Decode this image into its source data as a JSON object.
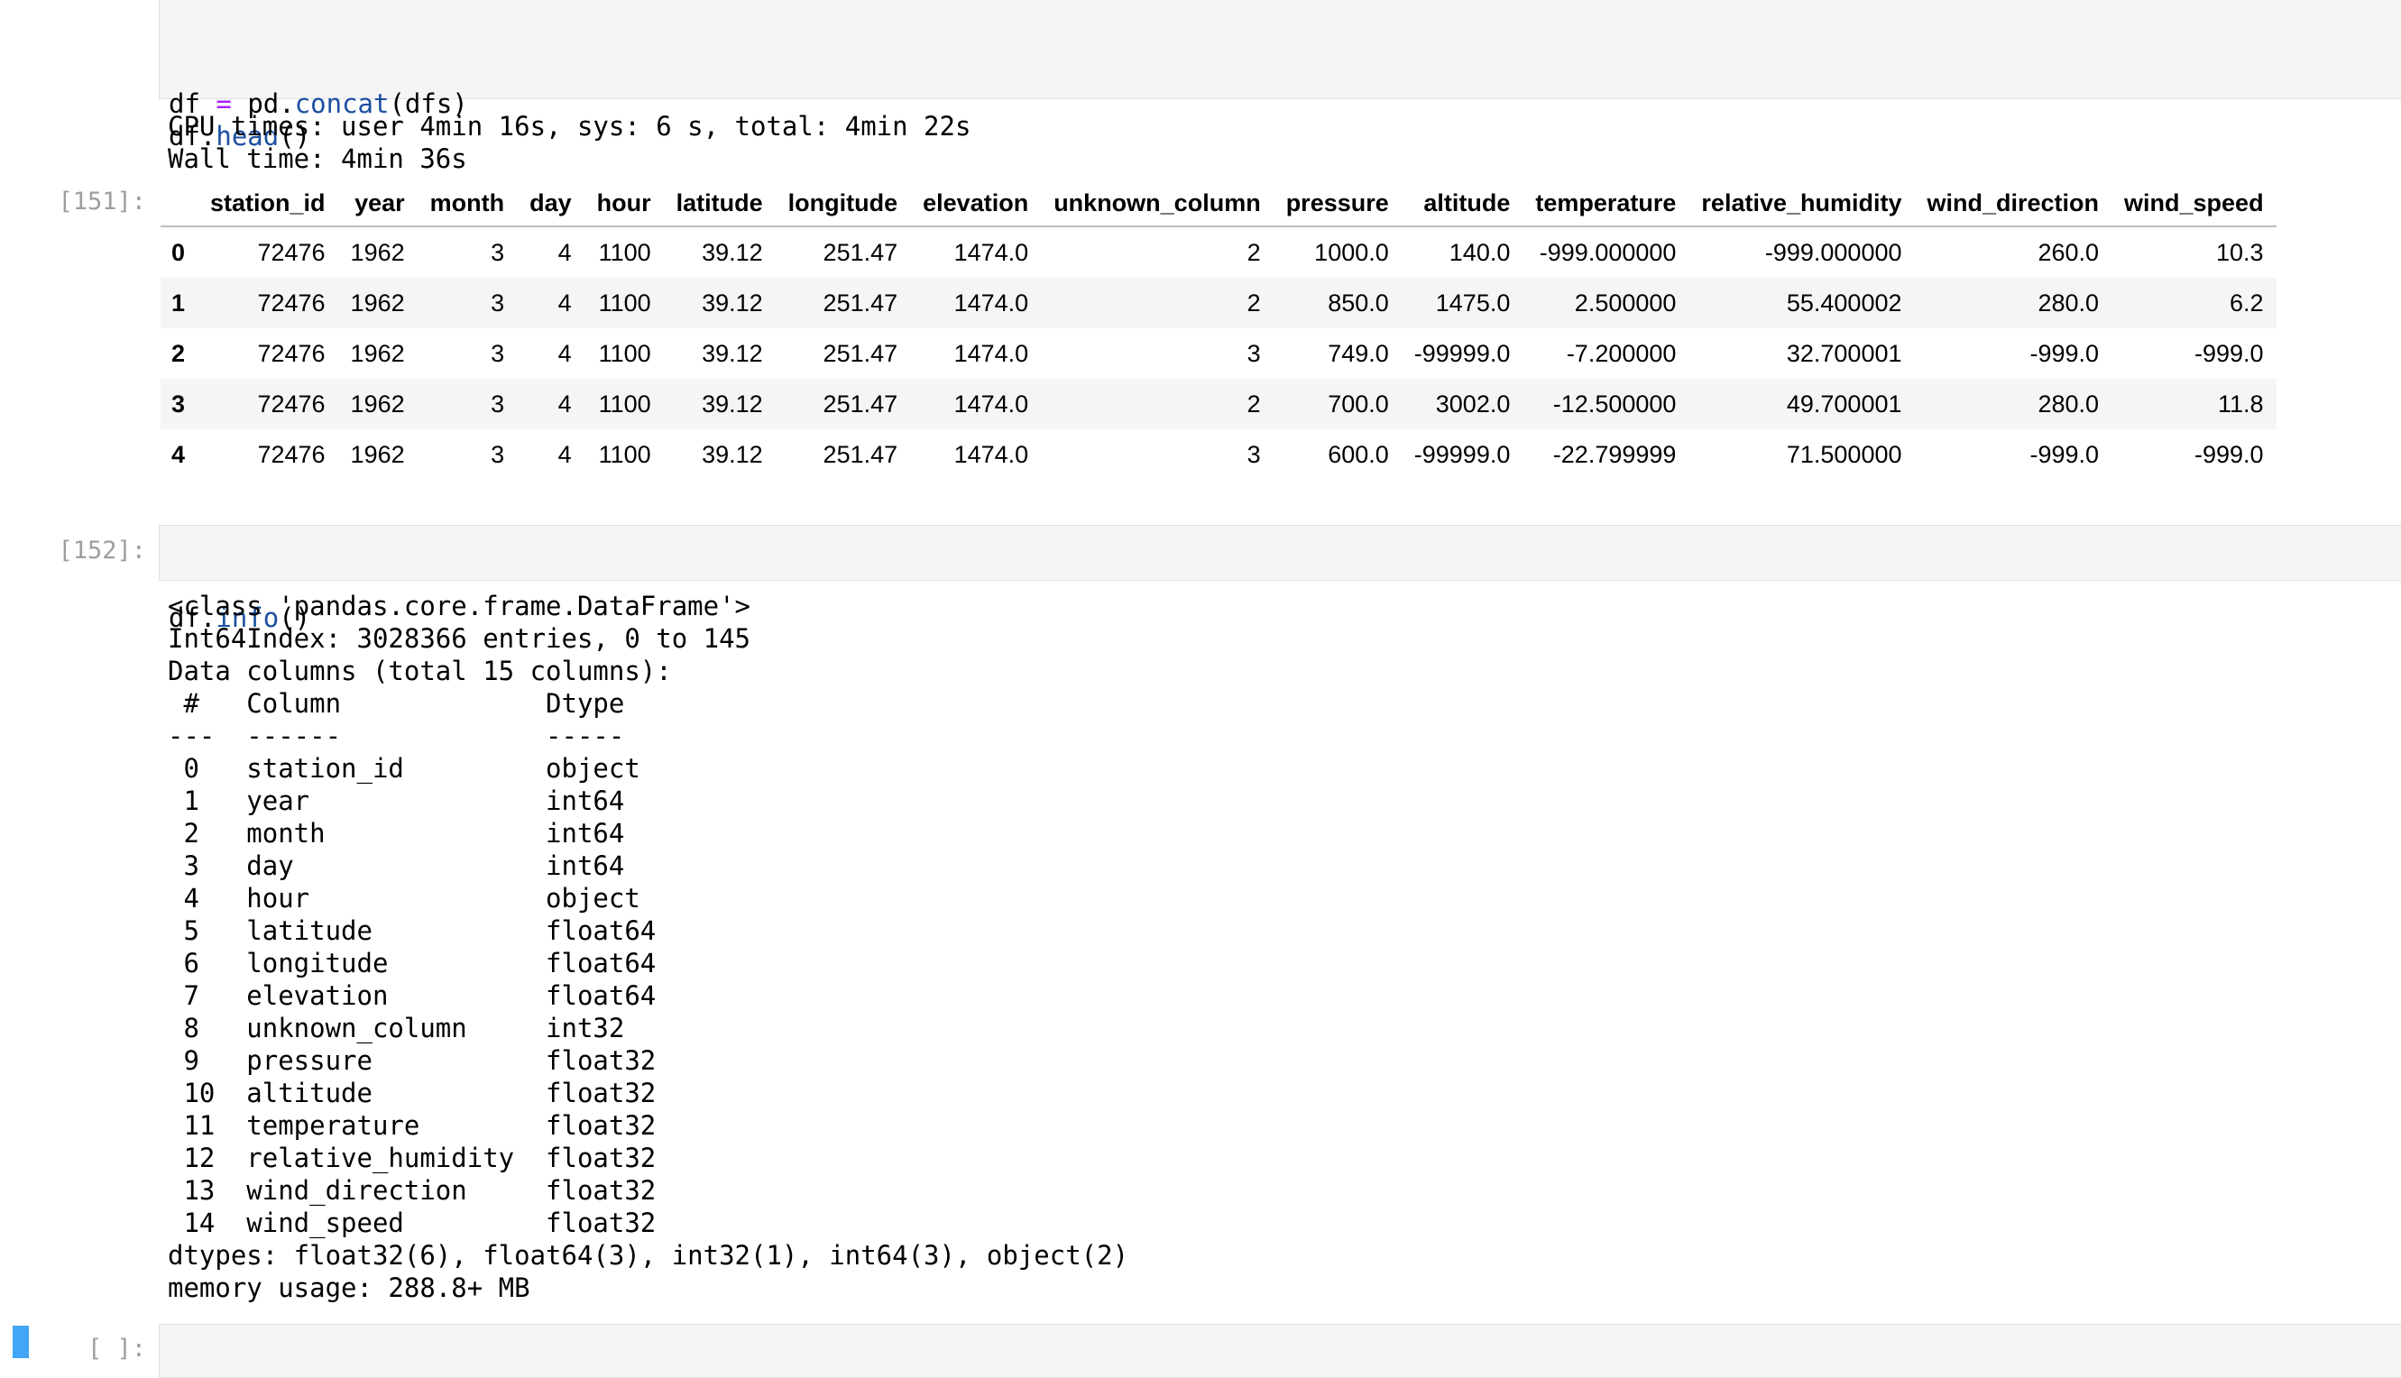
{
  "cell_concat": {
    "code_lines": [
      [
        [
          "df ",
          ""
        ],
        [
          "=",
          "op"
        ],
        [
          " pd.",
          ""
        ],
        [
          "concat",
          "fn"
        ],
        [
          "(dfs)",
          ""
        ]
      ],
      [
        [
          "df.",
          ""
        ],
        [
          "head",
          "fn"
        ],
        [
          "()",
          ""
        ]
      ]
    ]
  },
  "timing_output": {
    "cpu_times": "CPU times: user 4min 16s, sys: 6 s, total: 4min 22s",
    "wall_time": "Wall time: 4min 36s"
  },
  "cell_151": {
    "prompt": "[151]:",
    "columns": [
      "",
      "station_id",
      "year",
      "month",
      "day",
      "hour",
      "latitude",
      "longitude",
      "elevation",
      "unknown_column",
      "pressure",
      "altitude",
      "temperature",
      "relative_humidity",
      "wind_direction",
      "wind_speed"
    ],
    "rows": [
      [
        "0",
        "72476",
        "1962",
        "3",
        "4",
        "1100",
        "39.12",
        "251.47",
        "1474.0",
        "2",
        "1000.0",
        "140.0",
        "-999.000000",
        "-999.000000",
        "260.0",
        "10.3"
      ],
      [
        "1",
        "72476",
        "1962",
        "3",
        "4",
        "1100",
        "39.12",
        "251.47",
        "1474.0",
        "2",
        "850.0",
        "1475.0",
        "2.500000",
        "55.400002",
        "280.0",
        "6.2"
      ],
      [
        "2",
        "72476",
        "1962",
        "3",
        "4",
        "1100",
        "39.12",
        "251.47",
        "1474.0",
        "3",
        "749.0",
        "-99999.0",
        "-7.200000",
        "32.700001",
        "-999.0",
        "-999.0"
      ],
      [
        "3",
        "72476",
        "1962",
        "3",
        "4",
        "1100",
        "39.12",
        "251.47",
        "1474.0",
        "2",
        "700.0",
        "3002.0",
        "-12.500000",
        "49.700001",
        "280.0",
        "11.8"
      ],
      [
        "4",
        "72476",
        "1962",
        "3",
        "4",
        "1100",
        "39.12",
        "251.47",
        "1474.0",
        "3",
        "600.0",
        "-99999.0",
        "-22.799999",
        "71.500000",
        "-999.0",
        "-999.0"
      ]
    ]
  },
  "cell_152": {
    "prompt": "[152]:",
    "code_lines": [
      [
        [
          "df.",
          ""
        ],
        [
          "info",
          "fn"
        ],
        [
          "()",
          ""
        ]
      ]
    ],
    "output_lines": [
      "<class 'pandas.core.frame.DataFrame'>",
      "Int64Index: 3028366 entries, 0 to 145",
      "Data columns (total 15 columns):",
      " #   Column             Dtype  ",
      "---  ------             -----  ",
      " 0   station_id         object ",
      " 1   year               int64  ",
      " 2   month              int64  ",
      " 3   day                int64  ",
      " 4   hour               object ",
      " 5   latitude           float64",
      " 6   longitude          float64",
      " 7   elevation          float64",
      " 8   unknown_column     int32  ",
      " 9   pressure           float32",
      " 10  altitude           float32",
      " 11  temperature        float32",
      " 12  relative_humidity  float32",
      " 13  wind_direction     float32",
      " 14  wind_speed         float32",
      "dtypes: float32(6), float64(3), int32(1), int64(3), object(2)",
      "memory usage: 288.8+ MB"
    ]
  },
  "cell_empty": {
    "prompt": "[ ]:"
  },
  "colors": {
    "prompt": "#9e9e9e",
    "operator": "#aa22ff",
    "function": "#1b4fa0",
    "cell_background": "#f5f5f5",
    "active_indicator": "#42a5f5"
  }
}
